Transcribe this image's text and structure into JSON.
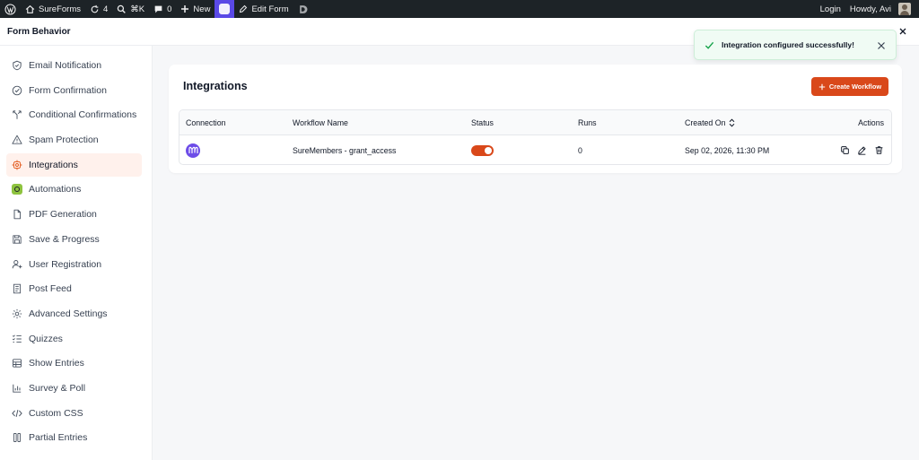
{
  "admin_bar": {
    "site_name": "SureForms",
    "updates_count": "4",
    "search_shortcut": "⌘K",
    "comments_count": "0",
    "new_label": "New",
    "edit_form_label": "Edit Form",
    "login_label": "Login",
    "greeting": "Howdy, Avi"
  },
  "header": {
    "title": "Form Behavior"
  },
  "sidebar": {
    "items": [
      {
        "label": "Email Notification",
        "icon": "shield-icon"
      },
      {
        "label": "Form Confirmation",
        "icon": "check-circle-icon"
      },
      {
        "label": "Conditional Confirmations",
        "icon": "split-icon"
      },
      {
        "label": "Spam Protection",
        "icon": "warning-icon"
      },
      {
        "label": "Integrations",
        "icon": "integrations-icon",
        "active": true
      },
      {
        "label": "Automations",
        "icon": "automations-icon"
      },
      {
        "label": "PDF Generation",
        "icon": "file-icon"
      },
      {
        "label": "Save & Progress",
        "icon": "save-icon"
      },
      {
        "label": "User Registration",
        "icon": "user-plus-icon"
      },
      {
        "label": "Post Feed",
        "icon": "document-icon"
      },
      {
        "label": "Advanced Settings",
        "icon": "gear-icon"
      },
      {
        "label": "Quizzes",
        "icon": "list-check-icon"
      },
      {
        "label": "Show Entries",
        "icon": "table-icon"
      },
      {
        "label": "Survey & Poll",
        "icon": "bar-chart-icon"
      },
      {
        "label": "Custom CSS",
        "icon": "code-icon"
      },
      {
        "label": "Partial Entries",
        "icon": "columns-icon"
      }
    ]
  },
  "main": {
    "title": "Integrations",
    "create_button_label": "Create Workflow",
    "table": {
      "columns": [
        "Connection",
        "Workflow Name",
        "Status",
        "Runs",
        "Created On",
        "Actions"
      ],
      "rows": [
        {
          "connection_icon": "suremembers-logo-icon",
          "workflow_name": "SureMembers - grant_access",
          "status_enabled": true,
          "runs": "0",
          "created_on": "Sep 02, 2026, 11:30 PM"
        }
      ]
    }
  },
  "toast": {
    "message": "Integration configured successfully!"
  },
  "colors": {
    "accent": "#d9481a",
    "admin_bar": "#1d2327",
    "success": "#16a34a",
    "suresforms_purple": "#5a49e6"
  }
}
